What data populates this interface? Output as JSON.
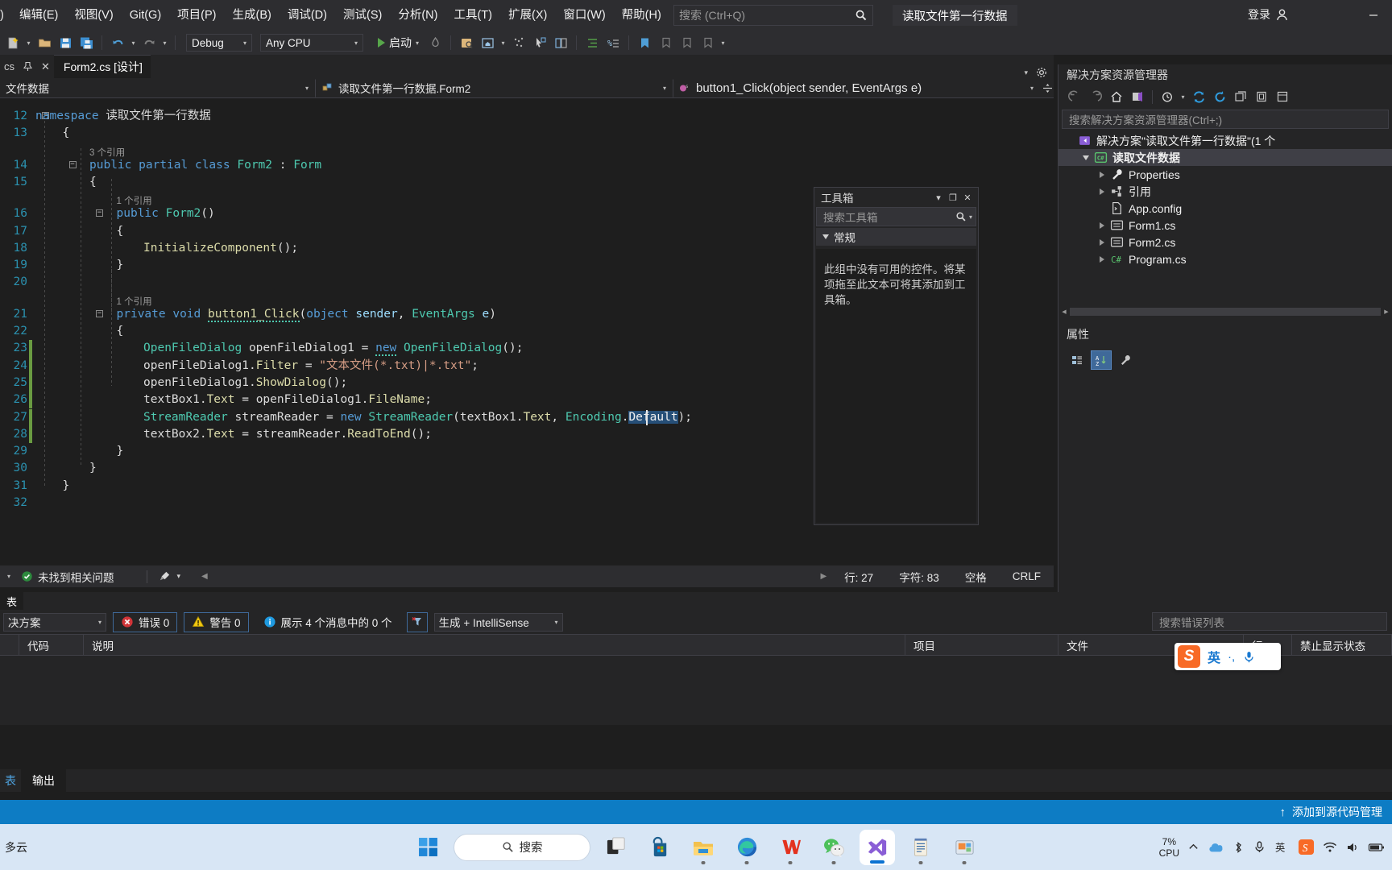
{
  "titlebar": {
    "menu_items": [
      ")",
      "编辑(E)",
      "视图(V)",
      "Git(G)",
      "项目(P)",
      "生成(B)",
      "调试(D)",
      "测试(S)",
      "分析(N)",
      "工具(T)",
      "扩展(X)",
      "窗口(W)",
      "帮助(H)"
    ],
    "search_placeholder": "搜索 (Ctrl+Q)",
    "project_title": "读取文件第一行数据",
    "account_label": "登录",
    "minimize": "—"
  },
  "toolbar": {
    "config_value": "Debug",
    "platform_value": "Any CPU",
    "run_label": "启动"
  },
  "editor_tabs": {
    "pin_label": "cs",
    "tab_label": "Form2.cs [设计]",
    "close_glyph": "✕"
  },
  "navbar": {
    "file_dropdown": "文件数据",
    "type_dropdown": "读取文件第一行数据.Form2",
    "member_dropdown": "button1_Click(object sender, EventArgs e)"
  },
  "code": {
    "lines": [
      {
        "num": "12",
        "indent": 0,
        "html": "<span class=\"kw\">namespace</span> <span class=\"nsp\">读取文件第一行数据</span>",
        "collapse": true
      },
      {
        "num": "13",
        "indent": 1,
        "html": "<span class=\"txt\">{</span>"
      },
      {
        "num": "14",
        "indent": 2,
        "html": "<span class=\"kw\">public</span> <span class=\"kw\">partial</span> <span class=\"kw\">class</span> <span class=\"typ\">Form2</span> <span class=\"txt\">:</span> <span class=\"typ\">Form</span>",
        "ref": "3 个引用",
        "collapse": true
      },
      {
        "num": "15",
        "indent": 2,
        "html": "<span class=\"txt\">{</span>"
      },
      {
        "num": "16",
        "indent": 3,
        "html": "<span class=\"kw\">public</span> <span class=\"typ\">Form2</span><span class=\"txt\">()</span>",
        "ref": "1 个引用",
        "collapse": true
      },
      {
        "num": "17",
        "indent": 3,
        "html": "<span class=\"txt\">{</span>"
      },
      {
        "num": "18",
        "indent": 4,
        "html": "<span class=\"mth\">InitializeComponent</span><span class=\"txt\">();</span>"
      },
      {
        "num": "19",
        "indent": 3,
        "html": "<span class=\"txt\">}</span>"
      },
      {
        "num": "20",
        "indent": 0,
        "html": ""
      },
      {
        "num": "21",
        "indent": 3,
        "html": "<span class=\"kw\">private</span> <span class=\"kw\">void</span> <span class=\"mth squig\">button1_Click</span><span class=\"txt\">(</span><span class=\"kw\">object</span> <span class=\"prm\">sender</span><span class=\"txt\">,</span> <span class=\"typ\">EventArgs</span> <span class=\"prm\">e</span><span class=\"txt\">)</span>",
        "ref": "1 个引用",
        "collapse": true
      },
      {
        "num": "22",
        "indent": 3,
        "html": "<span class=\"txt\">{</span>"
      },
      {
        "num": "23",
        "indent": 4,
        "html": "<span class=\"typ\">OpenFileDialog</span> <span class=\"txt\">openFileDialog1 =</span> <span class=\"kw squig\">new</span> <span class=\"typ\">OpenFileDialog</span><span class=\"txt\">();</span>",
        "changed": true
      },
      {
        "num": "24",
        "indent": 4,
        "html": "<span class=\"txt\">openFileDialog1.</span><span class=\"mth\">Filter</span> <span class=\"txt\">=</span> <span class=\"str\">\"文本文件(*.txt)|*.txt\"</span><span class=\"txt\">;</span>",
        "changed": true
      },
      {
        "num": "25",
        "indent": 4,
        "html": "<span class=\"txt\">openFileDialog1.</span><span class=\"mth\">ShowDialog</span><span class=\"txt\">();</span>",
        "changed": true
      },
      {
        "num": "26",
        "indent": 4,
        "html": "<span class=\"txt\">textBox1.</span><span class=\"mth\">Text</span> <span class=\"txt\">= openFileDialog1.</span><span class=\"mth\">FileName</span><span class=\"txt\">;</span>",
        "changed": true
      },
      {
        "num": "27",
        "indent": 4,
        "html": "<span class=\"typ\">StreamReader</span> <span class=\"txt\">streamReader =</span> <span class=\"kw\">new</span> <span class=\"typ\">StreamReader</span><span class=\"txt\">(textBox1.</span><span class=\"mth\">Text</span><span class=\"txt\">,</span> <span class=\"typ\">Encoding</span><span class=\"txt\">.</span><span class=\"sel\">Default</span><span class=\"txt\">);</span>",
        "changed": true,
        "caret": true
      },
      {
        "num": "28",
        "indent": 4,
        "html": "<span class=\"txt\">textBox2.</span><span class=\"mth\">Text</span> <span class=\"txt\">= streamReader.</span><span class=\"mth\">ReadToEnd</span><span class=\"txt\">();</span>",
        "changed": true
      },
      {
        "num": "29",
        "indent": 3,
        "html": "<span class=\"txt\">}</span>"
      },
      {
        "num": "30",
        "indent": 2,
        "html": "<span class=\"txt\">}</span>"
      },
      {
        "num": "31",
        "indent": 1,
        "html": "<span class=\"txt\">}</span>"
      },
      {
        "num": "32",
        "indent": 0,
        "html": ""
      }
    ]
  },
  "toolbox": {
    "title": "工具箱",
    "search_placeholder": "搜索工具箱",
    "group_label": "常规",
    "empty_message": "此组中没有可用的控件。将某项拖至此文本可将其添加到工具箱。",
    "minimize": "▾",
    "maximize": "❐",
    "close": "✕"
  },
  "solution_explorer": {
    "title": "解决方案资源管理器",
    "search_placeholder": "搜索解决方案资源管理器(Ctrl+;)",
    "tree": [
      {
        "label": "解决方案\"读取文件第一行数据\"(1 个",
        "icon": "solution-icon",
        "depth": 0,
        "expander": "none",
        "selected": false
      },
      {
        "label": "读取文件数据",
        "icon": "csproj-icon",
        "depth": 1,
        "expander": "down",
        "selected": true
      },
      {
        "label": "Properties",
        "icon": "wrench-icon",
        "depth": 2,
        "expander": "right",
        "selected": false
      },
      {
        "label": "引用",
        "icon": "references-icon",
        "depth": 2,
        "expander": "right",
        "selected": false
      },
      {
        "label": "App.config",
        "icon": "config-file-icon",
        "depth": 2,
        "expander": "none",
        "selected": false
      },
      {
        "label": "Form1.cs",
        "icon": "form-icon",
        "depth": 2,
        "expander": "right",
        "selected": false
      },
      {
        "label": "Form2.cs",
        "icon": "form-icon",
        "depth": 2,
        "expander": "right",
        "selected": false
      },
      {
        "label": "Program.cs",
        "icon": "csharp-file-icon",
        "depth": 2,
        "expander": "right",
        "selected": false
      }
    ]
  },
  "properties_panel": {
    "title": "属性"
  },
  "editor_status": {
    "issues_label": "未找到相关问题",
    "line_label": "行: 27",
    "char_label": "字符: 83",
    "spaces_label": "空格",
    "eol_label": "CRLF"
  },
  "error_list": {
    "tab_label": "表",
    "scope_value": "决方案",
    "errors_label": "错误 0",
    "warnings_label": "警告 0",
    "messages_label": "展示 4 个消息中的 0 个",
    "build_filter_value": "生成 + IntelliSense",
    "search_placeholder": "搜索错误列表",
    "columns": [
      "",
      "代码",
      "说明",
      "项目",
      "文件",
      "行",
      "禁止显示状态"
    ]
  },
  "output_tabs": {
    "left_tab": "表",
    "active_tab": "输出"
  },
  "vs_status": {
    "source_control_label": "添加到源代码管理",
    "up_arrow": "↑"
  },
  "taskbar": {
    "weather": "多云",
    "search_label": "搜索",
    "cpu_percent": "7%",
    "cpu_label": "CPU",
    "apps": [
      {
        "name": "start-button"
      },
      {
        "name": "search-pill"
      },
      {
        "name": "taskview-button"
      },
      {
        "name": "microsoft-store"
      },
      {
        "name": "file-explorer"
      },
      {
        "name": "microsoft-edge"
      },
      {
        "name": "wps-office"
      },
      {
        "name": "wechat"
      },
      {
        "name": "visual-studio"
      },
      {
        "name": "notes-app"
      },
      {
        "name": "screenshot-tool"
      }
    ]
  },
  "ime": {
    "mode": "英",
    "dots": "·,"
  },
  "colors": {
    "accent": "#0d7cc4",
    "editor_bg": "#1e1e1e",
    "chrome_bg": "#2d2d30",
    "panel_bg": "#252526",
    "keyword": "#569cd6",
    "type": "#4ec9b0",
    "string": "#d69d85",
    "method": "#dcdcaa",
    "linenum": "#2b91af",
    "selection": "#264f78",
    "taskbar_bg": "#d8e6f5"
  }
}
